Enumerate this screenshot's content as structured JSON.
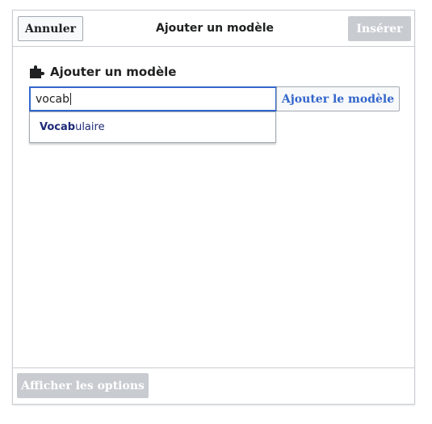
{
  "header": {
    "cancel_label": "Annuler",
    "title": "Ajouter un modèle",
    "insert_label": "Insérer"
  },
  "search": {
    "section_title": "Ajouter un modèle",
    "value": "vocab",
    "add_button_label": "Ajouter le modèle",
    "suggestions": [
      {
        "match": "Vocab",
        "rest": "ulaire"
      }
    ]
  },
  "footer": {
    "options_label": "Afficher les options"
  },
  "icons": {
    "section_icon": "puzzle-piece-icon"
  },
  "colors": {
    "accent": "#3366cc",
    "disabled": "#c8ccd1",
    "suggestion_text": "#1e2a78"
  }
}
